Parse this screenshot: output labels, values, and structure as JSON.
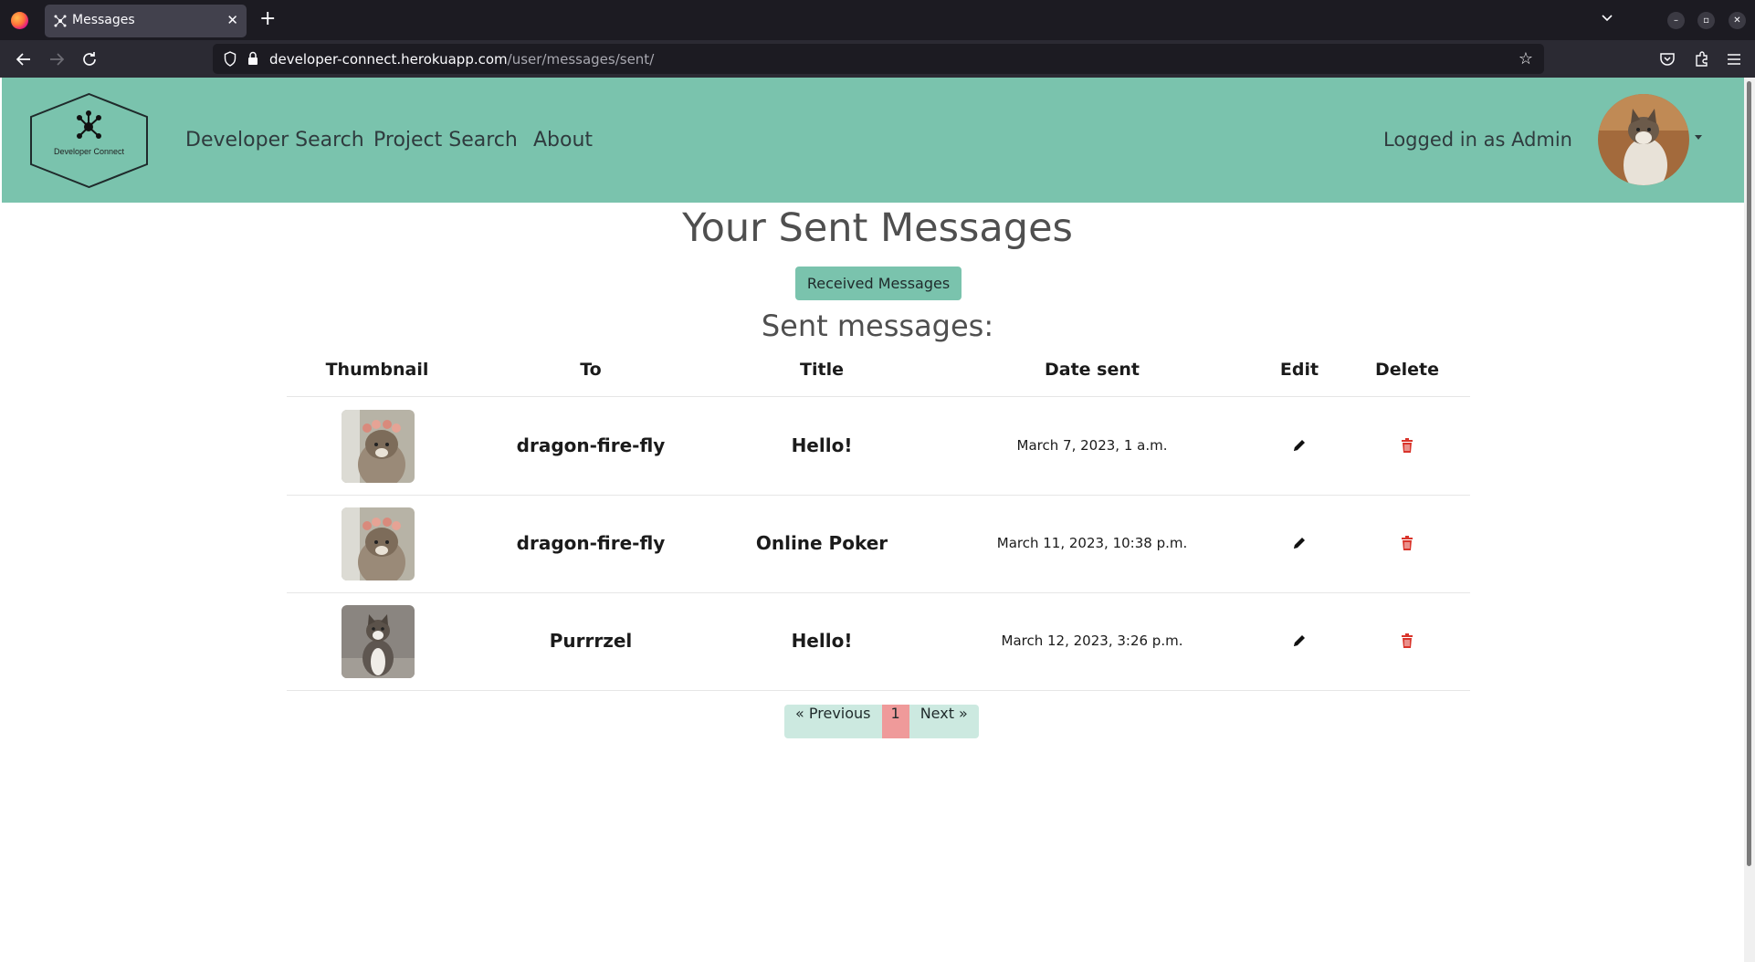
{
  "browser": {
    "tab_title": "Messages",
    "url_domain": "developer-connect.herokuapp.com",
    "url_path": "/user/messages/sent/",
    "new_tab_glyph": "+",
    "close_glyph": "✕"
  },
  "site": {
    "logo_text": "Developer Connect",
    "nav": [
      "Developer Search",
      "Project Search",
      "About"
    ],
    "logged_in": "Logged in as Admin"
  },
  "page": {
    "title": "Your Sent Messages",
    "received_button": "Received Messages",
    "subtitle": "Sent messages:"
  },
  "table": {
    "headers": [
      "Thumbnail",
      "To",
      "Title",
      "Date sent",
      "Edit",
      "Delete"
    ],
    "rows": [
      {
        "to": "dragon-fire-fly",
        "title": "Hello!",
        "date": "March 7, 2023, 1 a.m.",
        "thumb": "cat-with-flower-crown"
      },
      {
        "to": "dragon-fire-fly",
        "title": "Online Poker",
        "date": "March 11, 2023, 10:38 p.m.",
        "thumb": "cat-with-flower-crown"
      },
      {
        "to": "Purrrzel",
        "title": "Hello!",
        "date": "March 12, 2023, 3:26 p.m.",
        "thumb": "tabby-cat-sitting"
      }
    ]
  },
  "pagination": {
    "prev": "« Previous",
    "current": "1",
    "next": "Next »"
  },
  "colors": {
    "header_bg": "#7ac3ad",
    "delete_icon": "#d9342b",
    "page_active": "#ef9a9a",
    "page_inactive": "#cce9e0"
  },
  "icons": {
    "edit": "pencil-icon",
    "delete": "trash-icon"
  }
}
